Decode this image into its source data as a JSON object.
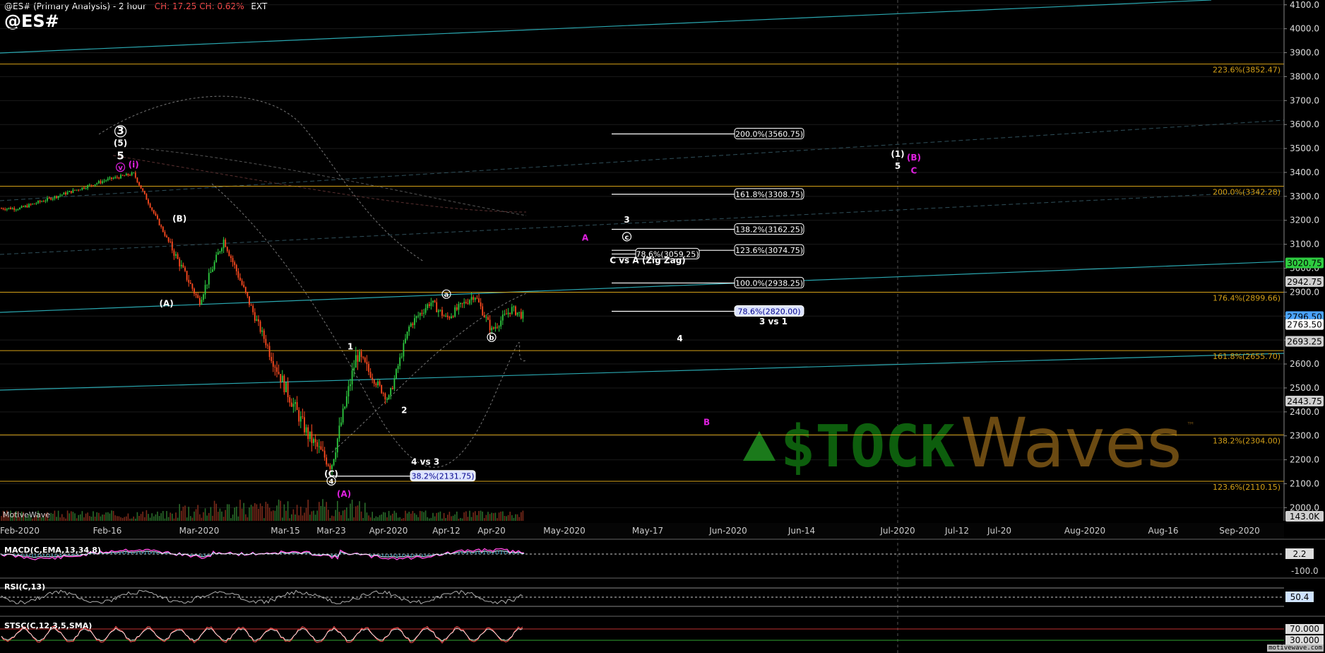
{
  "header": {
    "title": "@ES# (Primary Analysis) - 2 hour",
    "change": "CH: 17.25  CH: 0.62%",
    "session": "EXT",
    "symbol": "@ES#"
  },
  "footer_brand": "MotiveWave",
  "watermark": "motivewave.com",
  "logo": {
    "text_stock": "$TOCK",
    "text_waves": "Waves",
    "tm": "™"
  },
  "colors": {
    "background": "#000000",
    "fib": "#d4a017",
    "trend": "#2aa7b0",
    "wave_white": "#ffffff",
    "wave_magenta": "#e020e0",
    "bull_candle": "#2ecc40",
    "bear_candle": "#ff4b1f",
    "macd": "#ff4de0",
    "rsi": "#b0b0b0",
    "stoch": "#ff4d4d"
  },
  "chart_data": [
    {
      "type": "line",
      "title": "@ES# (Primary Analysis) - 2 hour",
      "xlabel": "",
      "ylabel": "",
      "y_ticks": [
        2000,
        2100,
        2200,
        2300,
        2400,
        2500,
        2600,
        2700,
        2800,
        2900,
        3000,
        3100,
        3200,
        3300,
        3400,
        3500,
        3600,
        3700,
        3800,
        3900,
        4000,
        4100
      ],
      "x_ticks": [
        "Feb-2020",
        "Feb-16",
        "Mar-2020",
        "Mar-15",
        "Mar-23",
        "Apr-2020",
        "Apr-12",
        "Apr-20",
        "May-2020",
        "May-17",
        "Jun-2020",
        "Jun-14",
        "Jul-2020",
        "Jul-12",
        "Jul-20",
        "Aug-2020",
        "Aug-16",
        "Sep-2020"
      ],
      "series": [
        {
          "x": [
            "Feb-2020",
            "Feb-16",
            "Feb-20",
            "Mar-2020",
            "Mar-05",
            "Mar-10",
            "Mar-15",
            "Mar-19",
            "Mar-23",
            "Mar-27",
            "Apr-2020",
            "Apr-05",
            "Apr-09",
            "Apr-12",
            "Apr-17",
            "Apr-20",
            "Apr-23",
            "Apr-27"
          ],
          "values": [
            3250,
            3370,
            3395,
            2860,
            3120,
            2800,
            2500,
            2300,
            2175,
            2640,
            2450,
            2760,
            2860,
            2790,
            2890,
            2740,
            2830,
            2764
          ]
        }
      ],
      "price_boxes": [
        {
          "value": 3020.75,
          "label": "3020.75",
          "color": "#2ecc40"
        },
        {
          "value": 2942.75,
          "label": "2942.75",
          "color": "#cfcfcf"
        },
        {
          "value": 2796.5,
          "label": "2796.50",
          "color": "#4aa3ff"
        },
        {
          "value": 2763.5,
          "label": "2763.50",
          "color": "#ffffff"
        },
        {
          "value": 2693.25,
          "label": "2693.25",
          "color": "#cfcfcf"
        },
        {
          "value": 2443.75,
          "label": "2443.75",
          "color": "#cfcfcf"
        },
        {
          "value": 1900,
          "label": "143.0K",
          "color": "#cfcfcf"
        }
      ],
      "fib_lines": [
        {
          "value": 3852.47,
          "label": "223.6%(3852.47)"
        },
        {
          "value": 3342.28,
          "label": "200.0%(3342.28)"
        },
        {
          "value": 2899.66,
          "label": "176.4%(2899.66)"
        },
        {
          "value": 2655.7,
          "label": "161.8%(2655.70)"
        },
        {
          "value": 2304.0,
          "label": "138.2%(2304.00)"
        },
        {
          "value": 2110.15,
          "label": "123.6%(2110.15)"
        }
      ],
      "target_levels": [
        {
          "value": 3560.75,
          "label": "200.0%(3560.75)"
        },
        {
          "value": 3308.75,
          "label": "161.8%(3308.75)"
        },
        {
          "value": 3162.25,
          "label": "138.2%(3162.25)"
        },
        {
          "value": 3074.75,
          "label": "123.6%(3074.75)"
        },
        {
          "value": 3059.25,
          "label": "78.6%(3059.25)"
        },
        {
          "value": 2938.25,
          "label": "100.0%(2938.25)"
        },
        {
          "value": 2820.0,
          "label": "78.6%(2820.00)"
        },
        {
          "value": 2131.75,
          "label": "38.2%(2131.75)"
        }
      ],
      "annotations": [
        {
          "text": "3",
          "x": "Feb-18",
          "value": 3560,
          "color": "#ffffff",
          "circled": true
        },
        {
          "text": "(5)",
          "x": "Feb-18",
          "value": 3510,
          "color": "#ffffff"
        },
        {
          "text": "5",
          "x": "Feb-18",
          "value": 3455,
          "color": "#ffffff"
        },
        {
          "text": "v",
          "x": "Feb-18",
          "value": 3410,
          "color": "#e020e0",
          "circled": true
        },
        {
          "text": "(i)",
          "x": "Feb-20",
          "value": 3420,
          "color": "#e020e0"
        },
        {
          "text": "(B)",
          "x": "Feb-27",
          "value": 3195,
          "color": "#ffffff"
        },
        {
          "text": "(A)",
          "x": "Feb-25",
          "value": 2840,
          "color": "#ffffff"
        },
        {
          "text": "1",
          "x": "Mar-26",
          "value": 2660,
          "color": "#ffffff"
        },
        {
          "text": "2",
          "x": "Apr-04",
          "value": 2395,
          "color": "#ffffff"
        },
        {
          "text": "a",
          "x": "Apr-12",
          "value": 2880,
          "color": "#ffffff",
          "circled": true
        },
        {
          "text": "b",
          "x": "Apr-20",
          "value": 2700,
          "color": "#ffffff",
          "circled": true
        },
        {
          "text": "(C)",
          "x": "Mar-23",
          "value": 2130,
          "color": "#ffffff"
        },
        {
          "text": "4",
          "x": "Mar-23",
          "value": 2100,
          "color": "#ffffff",
          "circled": true
        },
        {
          "text": "(A)",
          "x": "Mar-25",
          "value": 2045,
          "color": "#e020e0"
        },
        {
          "text": "4 vs 3",
          "x": "Apr-08",
          "value": 2180,
          "color": "#ffffff"
        },
        {
          "text": "3",
          "x": "May-13",
          "value": 3190,
          "color": "#ffffff"
        },
        {
          "text": "c",
          "x": "May-13",
          "value": 3120,
          "color": "#ffffff",
          "circled": true
        },
        {
          "text": "C vs A (Zig Zag)",
          "x": "May-17",
          "value": 3020,
          "color": "#ffffff"
        },
        {
          "text": "A",
          "x": "May-05",
          "value": 3115,
          "color": "#e020e0"
        },
        {
          "text": "4",
          "x": "May-23",
          "value": 2695,
          "color": "#ffffff"
        },
        {
          "text": "3 vs 1",
          "x": "Jun-09",
          "value": 2765,
          "color": "#ffffff"
        },
        {
          "text": "B",
          "x": "May-28",
          "value": 2345,
          "color": "#e020e0"
        },
        {
          "text": "(1)",
          "x": "Jul-2020",
          "value": 3465,
          "color": "#ffffff"
        },
        {
          "text": "5",
          "x": "Jul-2020",
          "value": 3415,
          "color": "#ffffff"
        },
        {
          "text": "(B)",
          "x": "Jul-04",
          "value": 3450,
          "color": "#e020e0"
        },
        {
          "text": "C",
          "x": "Jul-04",
          "value": 3395,
          "color": "#e020e0"
        }
      ]
    },
    {
      "type": "line",
      "title": "MACD(C,EMA,13,34,8)",
      "current_label": "2.2",
      "level_label": "-100.0"
    },
    {
      "type": "line",
      "title": "RSI(C,13)",
      "current_label": "50.4"
    },
    {
      "type": "line",
      "title": "STSC(C,12,3,5,SMA)",
      "upper_label": "70.000",
      "lower_label": "30.000"
    }
  ]
}
